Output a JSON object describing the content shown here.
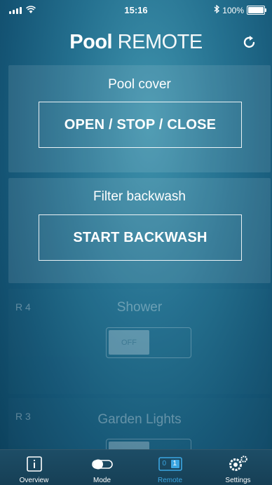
{
  "status": {
    "time": "15:16",
    "battery": "100%"
  },
  "header": {
    "title_bold": "Pool",
    "title_light": "REMOTE"
  },
  "cards": {
    "pool_cover": {
      "label": "Pool cover",
      "button": "OPEN / STOP / CLOSE"
    },
    "filter_backwash": {
      "label": "Filter backwash",
      "button": "START BACKWASH"
    },
    "shower": {
      "tag": "R 4",
      "label": "Shower",
      "toggle": "OFF"
    },
    "garden_lights": {
      "tag": "R 3",
      "label": "Garden Lights"
    }
  },
  "tabbar": {
    "tabs": [
      {
        "label": "Overview"
      },
      {
        "label": "Mode"
      },
      {
        "label": "Remote",
        "icon_left": "0",
        "icon_right": "1"
      },
      {
        "label": "Settings"
      }
    ]
  },
  "colors": {
    "active_tab": "#3ba6e2"
  }
}
